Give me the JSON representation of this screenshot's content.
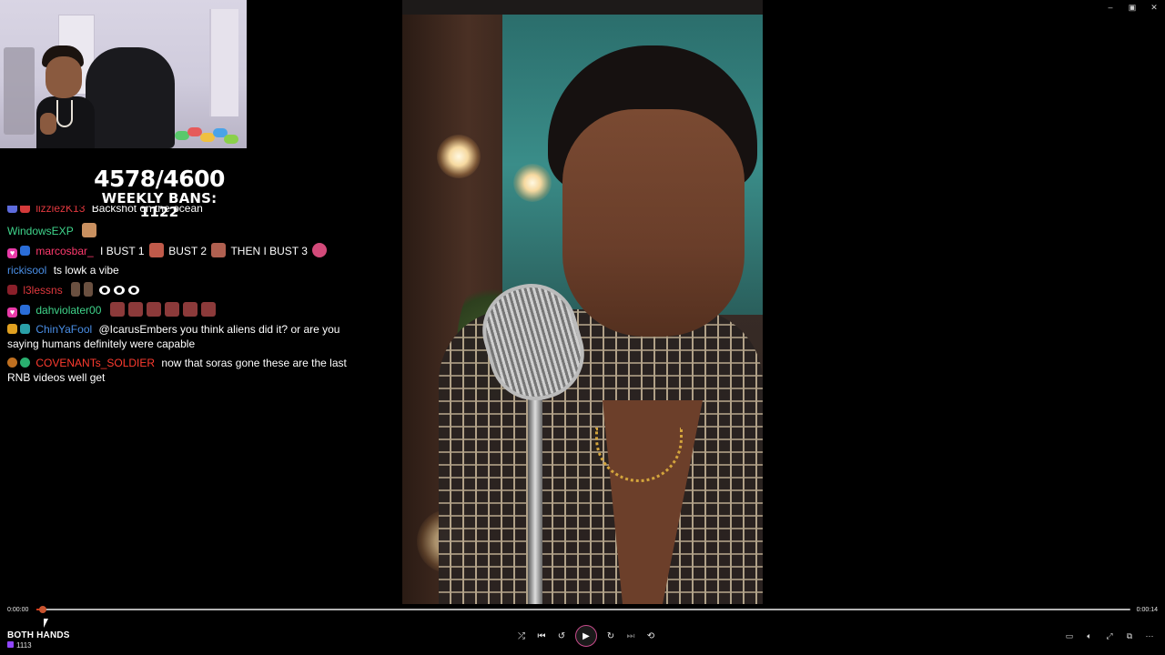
{
  "window": {
    "minimize_glyph": "–",
    "maximize_glyph": "▣",
    "close_glyph": "✕"
  },
  "overlay": {
    "ban_count": "4578/4600",
    "weekly_bans": "WEEKLY BANS: 1122"
  },
  "chat": {
    "messages": [
      {
        "user": "lizziezK13",
        "user_color": "#e0383e",
        "text": "Backshot on the ocean"
      },
      {
        "user": "WindowsEXP",
        "user_color": "#3fd48b",
        "text": ""
      },
      {
        "user": "marcosbar_",
        "user_color": "#ff3a6e",
        "text": "I BUST 1",
        "text2": "BUST 2",
        "text3": "THEN I BUST 3"
      },
      {
        "user": "rickisool",
        "user_color": "#4a8fe7",
        "text": "ts lowk a vibe"
      },
      {
        "user": "l3lessns",
        "user_color": "#e0383e",
        "text": ""
      },
      {
        "user": "dahviolater00",
        "user_color": "#3fd48b",
        "text": ""
      },
      {
        "user": "ChinYaFool",
        "user_color": "#4a8fe7",
        "text": "@IcarusEmbers you think aliens did it? or are you saying humans definitely were capable"
      },
      {
        "user": "COVENANTs_SOLDIER",
        "user_color": "#ff3b2f",
        "text": "now that soras gone these are the last RNB videos well get"
      }
    ]
  },
  "player": {
    "current_time": "0:00:00",
    "total_time": "0:00:14",
    "progress": 0.006,
    "song_title": "BOTH HANDS",
    "song_subtitle": "1113",
    "accent_color": "#c74b8b",
    "progress_color": "#d33b1b"
  },
  "controls": {
    "shuffle": "shuffle-icon",
    "previous": "previous-icon",
    "rewind": "rewind-icon",
    "play": "play-icon",
    "forward": "forward-icon",
    "next": "next-icon",
    "repeat": "repeat-icon"
  },
  "right_controls": [
    "miniplayer-icon",
    "volume-icon",
    "fullscreen-icon",
    "popout-icon",
    "more-icon"
  ]
}
